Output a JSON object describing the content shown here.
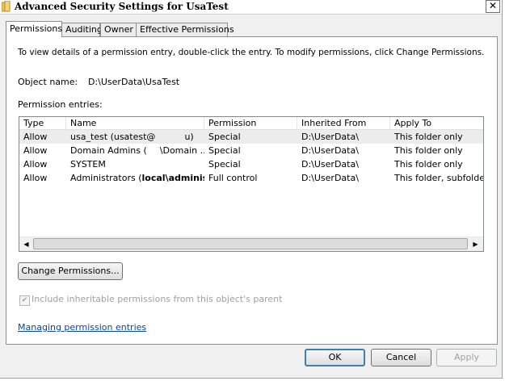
{
  "window": {
    "title": "Advanced Security Settings for UsaTest",
    "close_glyph": "✕"
  },
  "tabs": [
    {
      "label": "Permissions",
      "active": true
    },
    {
      "label": "Auditing"
    },
    {
      "label": "Owner"
    },
    {
      "label": "Effective Permissions"
    }
  ],
  "panel": {
    "instructions": "To view details of a permission entry, double-click the entry. To modify permissions, click Change Permissions.",
    "object_name_label": "Object name:",
    "object_name_value": "D:\\UserData\\UsaTest",
    "entries_label": "Permission entries:"
  },
  "list": {
    "columns": [
      "Type",
      "Name",
      "Permission",
      "Inherited From",
      "Apply To"
    ],
    "rows": [
      {
        "type": "Allow",
        "name": "usa_test (usatest@",
        "name_tail": "u)",
        "permission": "Special",
        "inherited": "D:\\UserData\\",
        "apply": "This folder only"
      },
      {
        "type": "Allow",
        "name": "Domain Admins (",
        "name_tail": "\\Domain ...",
        "permission": "Special",
        "inherited": "D:\\UserData\\",
        "apply": "This folder only"
      },
      {
        "type": "Allow",
        "name": "SYSTEM",
        "name_tail": "",
        "permission": "Special",
        "inherited": "D:\\UserData\\",
        "apply": "This folder only"
      },
      {
        "type": "Allow",
        "name": "Administrators (",
        "name_tail": "local\\administrator",
        "permission": "Full control",
        "inherited": "D:\\UserData\\",
        "apply": "This folder, subfolders a"
      }
    ]
  },
  "buttons": {
    "change_permissions": "Change Permissions...",
    "ok": "OK",
    "cancel": "Cancel",
    "apply": "Apply"
  },
  "inherit_checkbox": {
    "label": "Include inheritable permissions from this object's parent",
    "checked": true,
    "disabled": true
  },
  "link_text": "Managing permission entries"
}
